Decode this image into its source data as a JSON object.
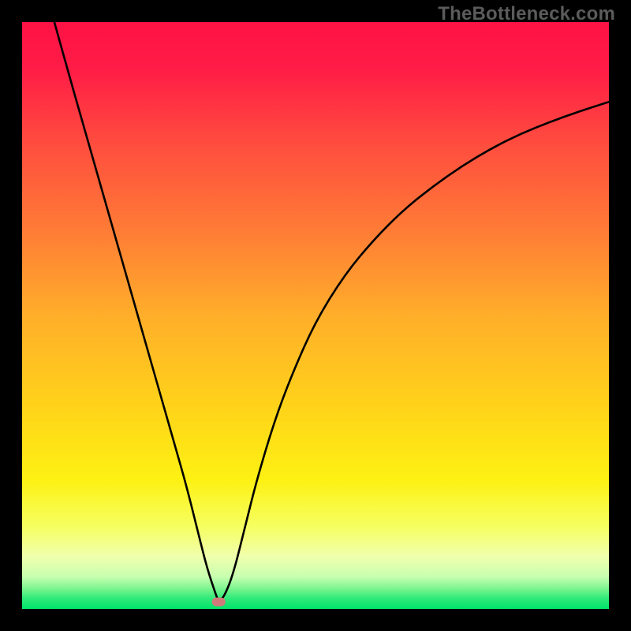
{
  "watermark": "TheBottleneck.com",
  "chart_data": {
    "type": "line",
    "title": "",
    "xlabel": "",
    "ylabel": "",
    "xlim": [
      0,
      100
    ],
    "ylim": [
      0,
      100
    ],
    "grid": false,
    "legend": false,
    "background_gradient": {
      "top_color": "#ff1846",
      "mid_color": "#ffd400",
      "bottom_band_color": "#f7ff9a",
      "base_color": "#00e86b"
    },
    "marker": {
      "x": 33.5,
      "y": 1.2,
      "color": "#d17a7a",
      "shape": "rounded-rect"
    },
    "series": [
      {
        "name": "bottleneck-curve",
        "x": [
          5.5,
          8,
          10,
          12,
          14,
          16,
          18,
          20,
          22,
          24,
          26,
          28,
          30,
          31.5,
          33,
          33.5,
          34.5,
          36,
          38,
          40,
          43,
          46,
          50,
          55,
          60,
          65,
          70,
          75,
          80,
          85,
          90,
          95,
          100
        ],
        "y": [
          100,
          91,
          84,
          77,
          70,
          63,
          56,
          49,
          42,
          35,
          28,
          21,
          13,
          7,
          2.5,
          1.2,
          2.2,
          6,
          14,
          22,
          32,
          40,
          49,
          57,
          63,
          68,
          72,
          75.5,
          78.5,
          81,
          83,
          84.8,
          86.4
        ]
      }
    ]
  }
}
